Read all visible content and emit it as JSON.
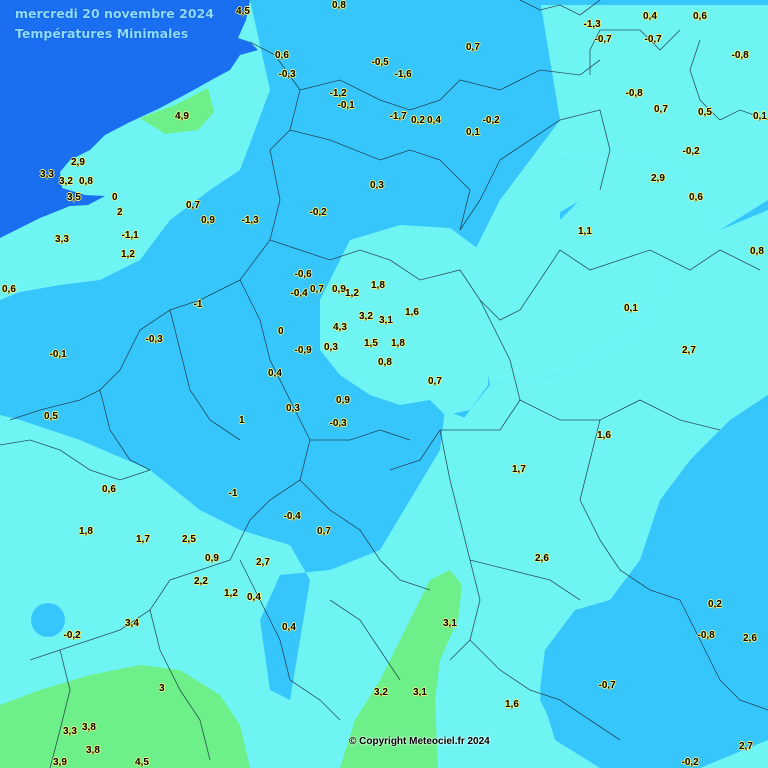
{
  "header": {
    "date": "mercredi 20 novembre 2024",
    "subtitle": "Températures Minimales"
  },
  "footer": {
    "copyright": "© Copyright Meteociel.fr 2024"
  },
  "colors": {
    "sea": "#1a6ef0",
    "medium_blue_zone": "#36c6fb",
    "light_cyan_zone": "#6ff4f4",
    "green_zone": "#6def8a",
    "label_outline": "#f4f17a"
  },
  "temperatures": [
    "4,5",
    "0,8",
    "0,4",
    "0,6",
    "-1,3",
    "-0,7",
    "-0,7",
    "0,7",
    "-0,8",
    "0,6",
    "-0,3",
    "-0,5",
    "-1,6",
    "-1,2",
    "-0,1",
    "-0,8",
    "0,7",
    "0,5",
    "0,1",
    "4,9",
    "-1,7",
    "0,2",
    "0,4",
    "-0,2",
    "0,1",
    "-0,2",
    "2,9",
    "3,3",
    "3,2",
    "0,8",
    "3,5",
    "0",
    "2",
    "0,3",
    "2,9",
    "0,6",
    "0,7",
    "0,9",
    "-1,3",
    "-0,2",
    "3,3",
    "-1,1",
    "1,2",
    "1,1",
    "0,8",
    "-0,6",
    "-0,4",
    "0,7",
    "0,9",
    "1,2",
    "1,8",
    "0,6",
    "-1",
    "-0,3",
    "0",
    "0,1",
    "3,2",
    "4,3",
    "3,1",
    "1,6",
    "-0,1",
    "-0,9",
    "0,3",
    "1,5",
    "1,8",
    "0,8",
    "0,4",
    "2,7",
    "0,7",
    "0,5",
    "0,3",
    "0,9",
    "1",
    "-0,3",
    "1,6",
    "1,7",
    "0,6",
    "-1",
    "-0,4",
    "0,7",
    "1,8",
    "1,7",
    "2,5",
    "0,9",
    "2,7",
    "2,6",
    "2,2",
    "1,2",
    "0,4",
    "0,2",
    "-0,8",
    "2,6",
    "0,4",
    "-0,2",
    "3,4",
    "3,1",
    "3",
    "3,2",
    "3,1",
    "-0,7",
    "1,6",
    "3,3",
    "3,8",
    "3,8",
    "2,7",
    "3,9",
    "4,5",
    "-0,2"
  ]
}
